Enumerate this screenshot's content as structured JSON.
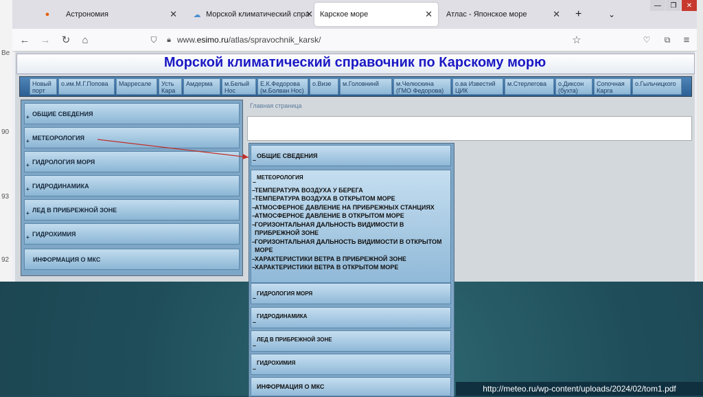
{
  "browser": {
    "tabs": [
      {
        "label": "Астрономия",
        "icon": "firefox-icon"
      },
      {
        "label": "Морской климатический спра",
        "icon": "cloud-icon"
      },
      {
        "label": "Карское море",
        "icon": ""
      },
      {
        "label": "Атлас - Японское море",
        "icon": ""
      }
    ],
    "url_prefix": "www.",
    "url_domain": "esimo.ru",
    "url_path": "/atlas/spravochnik_karsk/"
  },
  "page": {
    "title": "Морской климатический справочник по Карскому морю",
    "stations": [
      "Новый порт",
      "о.им.М.Г.Попова",
      "Марресале",
      "Усть Кара",
      "Амдерма",
      "м.Белый Нос",
      "Е.К.Федорова (м.Болван Нос)",
      "о.Визе",
      "м.Головнинй",
      "м.Челюскина (ГМО Федорова)",
      "о.ва Известий ЦИК",
      "м.Стерлегова",
      "о.Диксон (бухта)",
      "Сопочная Карга",
      "о.Гыльчицкого"
    ],
    "left_menu": [
      "ОБЩИЕ СВЕДЕНИЯ",
      "МЕТЕОРОЛОГИЯ",
      "ГИДРОЛОГИЯ МОРЯ",
      "ГИДРОДИНАМИКА",
      "ЛЕД В ПРИБРЕЖНОЙ ЗОНЕ",
      "ГИДРОХИМИЯ",
      "ИНФОРМАЦИЯ О МКС"
    ],
    "breadcrumb": "Главная страница"
  },
  "expanded_menu": {
    "sections_top": [
      "ОБЩИЕ СВЕДЕНИЯ",
      "МЕТЕОРОЛОГИЯ"
    ],
    "meteo_items": [
      "ТЕМПЕРАТУРА ВОЗДУХА У БЕРЕГА",
      "ТЕМПЕРАТУРА ВОЗДУХА В ОТКРЫТОМ МОРЕ",
      "АТМОСФЕРНОЕ ДАВЛЕНИЕ НА ПРИБРЕЖНЫХ СТАНЦИЯХ",
      "АТМОСФЕРНОЕ ДАВЛЕНИЕ В ОТКРЫТОМ МОРЕ",
      "ГОРИЗОНТАЛЬНАЯ ДАЛЬНОСТЬ ВИДИМОСТИ В ПРИБРЕЖНОЙ ЗОНЕ",
      "ГОРИЗОНТАЛЬНАЯ ДАЛЬНОСТЬ ВИДИМОСТИ В ОТКРЫТОМ МОРЕ",
      "ХАРАКТЕРИСТИКИ ВЕТРА В ПРИБРЕЖНОЙ ЗОНЕ",
      "ХАРАКТЕРИСТИКИ ВЕТРА В ОТКРЫТОМ МОРЕ"
    ],
    "sections_bottom": [
      "ГИДРОЛОГИЯ МОРЯ",
      "ГИДРОДИНАМИКА",
      "ЛЕД В ПРИБРЕЖНОЙ ЗОНЕ",
      "ГИДРОХИМИЯ",
      "ИНФОРМАЦИЯ О МКС"
    ]
  },
  "slide": {
    "source_url": "http://meteo.ru/wp-content/uploads/2024/02/tom1.pdf",
    "left_strip_labels": [
      "Ве",
      "90",
      "93",
      "92"
    ]
  }
}
